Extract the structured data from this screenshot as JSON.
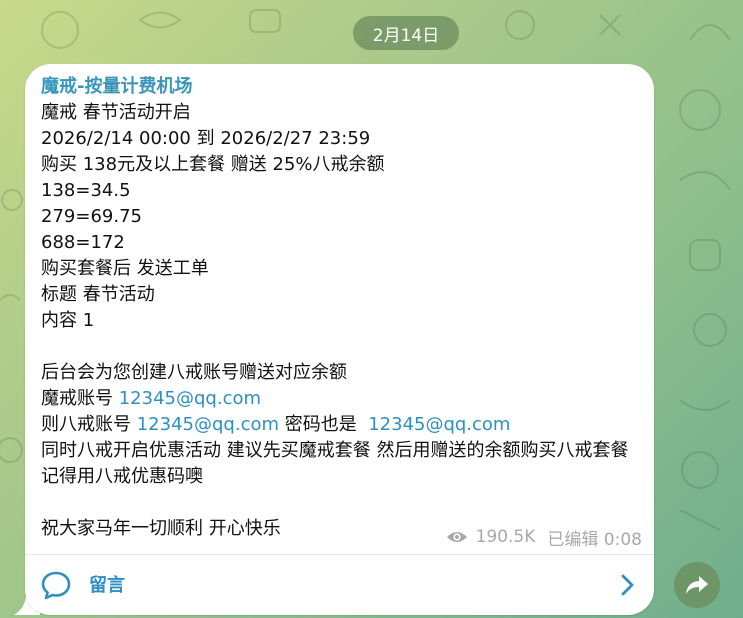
{
  "date_pill": "2月14日",
  "message": {
    "channel_name": "魔戒-按量计费机场",
    "lines": [
      "魔戒 春节活动开启",
      "2026/2/14 00:00 到 2026/2/27 23:59",
      "购买 138元及以上套餐 赠送 25%八戒余额",
      "138=34.5",
      "279=69.75",
      "688=172",
      "购买套餐后 发送工单",
      "标题 春节活动",
      "内容 1",
      "",
      "后台会为您创建八戒账号赠送对应余额"
    ],
    "account_line": {
      "prefix": "魔戒账号 ",
      "email": "12345@qq.com"
    },
    "bajie_line": {
      "prefix": "则八戒账号 ",
      "email": "12345@qq.com",
      "middle": " 密码也是  ",
      "email2": "12345@qq.com"
    },
    "promo_line": "同时八戒开启优惠活动 建议先买魔戒套餐 然后用赠送的余额购买八戒套餐 记得用八戒优惠码噢",
    "blank": "",
    "closing_line": "祝大家马年一切顺利 开心快乐",
    "views": "190.5K",
    "edited_time": "已编辑 0:08"
  },
  "comment_bar": {
    "label": "留言"
  },
  "icons": {
    "views": "eye-icon",
    "comment": "comment-bubble-icon",
    "chevron": "chevron-right-icon",
    "forward": "forward-share-icon"
  },
  "colors": {
    "accent": "#2f8ec2",
    "channel_name": "#3a95ba",
    "meta_text": "#a8a8a8",
    "pill_bg": "#6b8c5c"
  }
}
